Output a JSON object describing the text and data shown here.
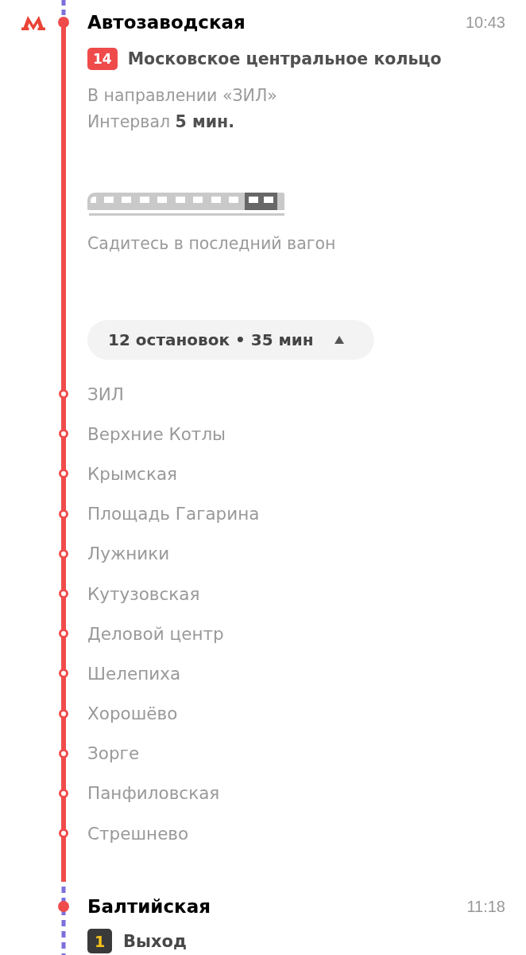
{
  "route": {
    "departure": {
      "station": "Автозаводская",
      "time": "10:43",
      "line": {
        "number": "14",
        "name": "Московское центральное кольцо"
      },
      "direction": "В направлении «ЗИЛ»",
      "interval": "Интервал **5 мин.**",
      "boarding_hint": "Садитесь в последний вагон"
    },
    "stops_toggle": {
      "label": "12 остановок • 35 мин",
      "expanded": true
    },
    "stops": [
      "ЗИЛ",
      "Верхние Котлы",
      "Крымская",
      "Площадь Гагарина",
      "Лужники",
      "Кутузовская",
      "Деловой центр",
      "Шелепиха",
      "Хорошёво",
      "Зорге",
      "Панфиловская",
      "Стрешнево"
    ],
    "arrival": {
      "station": "Балтийская",
      "time": "11:18",
      "exit": {
        "number": "1",
        "label": "Выход"
      }
    }
  }
}
